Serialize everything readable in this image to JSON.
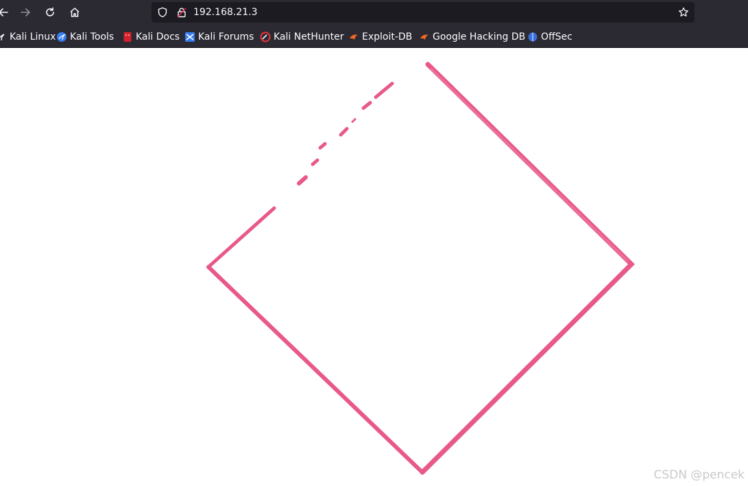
{
  "browser": {
    "url": "192.168.21.3",
    "bookmarks": [
      {
        "label": "Kali Linux",
        "icon": "kali-dragon-icon"
      },
      {
        "label": "Kali Tools",
        "icon": "kali-tools-icon"
      },
      {
        "label": "Kali Docs",
        "icon": "kali-docs-icon"
      },
      {
        "label": "Kali Forums",
        "icon": "kali-forums-icon"
      },
      {
        "label": "Kali NetHunter",
        "icon": "nethunter-icon"
      },
      {
        "label": "Exploit-DB",
        "icon": "exploit-db-icon"
      },
      {
        "label": "Google Hacking DB",
        "icon": "ghdb-icon"
      },
      {
        "label": "OffSec",
        "icon": "offsec-icon"
      }
    ]
  },
  "page": {
    "image_description_color": "#e8598a"
  },
  "watermark": "CSDN @pencek",
  "colors": {
    "chrome_bg": "#2b2a33",
    "url_bar_bg": "#1c1b22",
    "text": "#fbfbfe",
    "diamond_stroke": "#e8598a"
  }
}
